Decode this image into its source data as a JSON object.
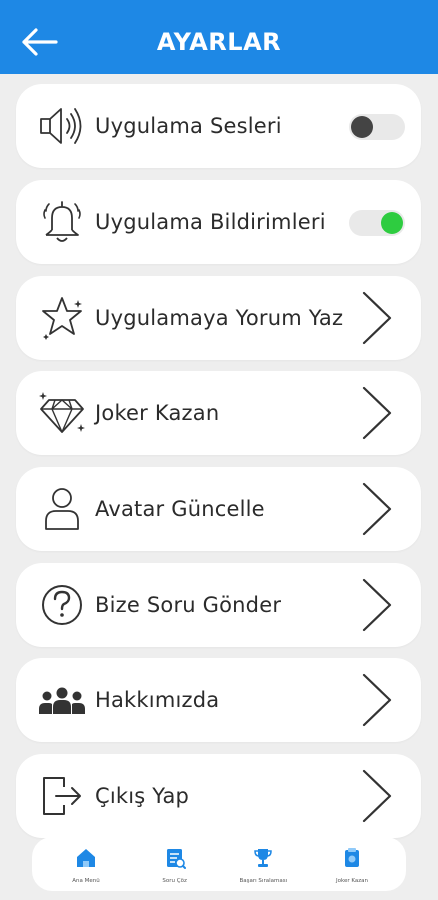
{
  "header": {
    "title": "AYARLAR",
    "back_icon": "arrow-left-icon"
  },
  "colors": {
    "header_bg": "#1e88e5",
    "accent": "#1e88e5",
    "toggle_on": "#2ecc40",
    "toggle_off_knob": "#444444"
  },
  "settings": [
    {
      "label": "Uygulama Sesleri",
      "icon": "speaker-icon",
      "control": "toggle",
      "enabled": false
    },
    {
      "label": "Uygulama Bildirimleri",
      "icon": "bell-icon",
      "control": "toggle",
      "enabled": true
    },
    {
      "label": "Uygulamaya Yorum Yaz",
      "icon": "star-icon",
      "control": "chevron"
    },
    {
      "label": "Joker Kazan",
      "icon": "diamond-icon",
      "control": "chevron"
    },
    {
      "label": "Avatar Güncelle",
      "icon": "user-icon",
      "control": "chevron"
    },
    {
      "label": "Bize Soru Gönder",
      "icon": "question-icon",
      "control": "chevron"
    },
    {
      "label": "Hakkımızda",
      "icon": "group-icon",
      "control": "chevron"
    },
    {
      "label": "Çıkış Yap",
      "icon": "logout-icon",
      "control": "chevron"
    }
  ],
  "bottom_nav": [
    {
      "label": "Ana Menü",
      "icon": "home-icon"
    },
    {
      "label": "Soru Çöz",
      "icon": "quiz-icon"
    },
    {
      "label": "Başarı Sıralaması",
      "icon": "trophy-icon"
    },
    {
      "label": "Joker Kazan",
      "icon": "joker-icon"
    }
  ]
}
